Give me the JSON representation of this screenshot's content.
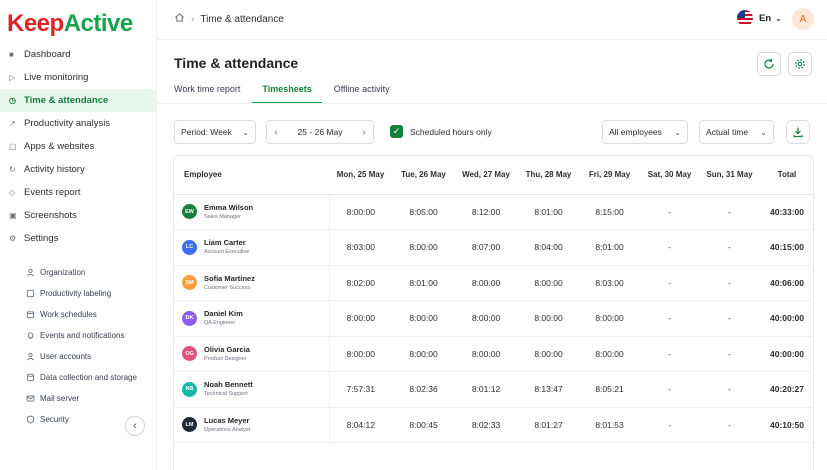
{
  "logo": {
    "part1": "Keep",
    "part2": "Active"
  },
  "nav": [
    {
      "label": "Dashboard",
      "icon": "■"
    },
    {
      "label": "Live monitoring",
      "icon": "▷"
    },
    {
      "label": "Time & attendance",
      "icon": "◷",
      "active": true
    },
    {
      "label": "Productivity analysis",
      "icon": "↗"
    },
    {
      "label": "Apps & websites",
      "icon": "▢"
    },
    {
      "label": "Activity history",
      "icon": "↻"
    },
    {
      "label": "Events report",
      "icon": "◇"
    },
    {
      "label": "Screenshots",
      "icon": "▣"
    },
    {
      "label": "Settings",
      "icon": "⚙"
    }
  ],
  "subnav": [
    "Organization",
    "Productivity labeling",
    "Work schedules",
    "Events and notifications",
    "User accounts",
    "Data collection and storage",
    "Mail server",
    "Security"
  ],
  "breadcrumb": {
    "current": "Time & attendance"
  },
  "lang": "En",
  "user_initial": "A",
  "page_title": "Time & attendance",
  "tabs": [
    "Work time report",
    "Timesheets",
    "Offline activity"
  ],
  "filters": {
    "period": "Period: Week",
    "range_start": "25",
    "range_sep": "-",
    "range_end": "26 May",
    "scheduled_only": "Scheduled hours only",
    "employees": "All employees",
    "time_mode": "Actual time"
  },
  "table": {
    "headers": [
      "Employee",
      "Mon, 25 May",
      "Tue, 26 May",
      "Wed, 27 May",
      "Thu, 28 May",
      "Fri, 29 May",
      "Sat, 30 May",
      "Sun, 31 May",
      "Total"
    ],
    "rows": [
      {
        "initials": "EW",
        "color": "#15803d",
        "name": "Emma Wilson",
        "role": "Sales Manager",
        "days": [
          "8:00:00",
          "8:05:00",
          "8:12:00",
          "8:01:00",
          "8:15:00",
          "-",
          "-"
        ],
        "total": "40:33:00"
      },
      {
        "initials": "LC",
        "color": "#3b6ff0",
        "name": "Liam Carter",
        "role": "Account Executive",
        "days": [
          "8:03:00",
          "8:00:00",
          "8:07:00",
          "8:04:00",
          "8:01:00",
          "-",
          "-"
        ],
        "total": "40:15:00"
      },
      {
        "initials": "SM",
        "color": "#f59e42",
        "name": "Sofia Martinez",
        "role": "Customer Success",
        "days": [
          "8:02:00",
          "8:01:00",
          "8:00:00",
          "8:00:00",
          "8:03:00",
          "-",
          "-"
        ],
        "total": "40:06:00"
      },
      {
        "initials": "DK",
        "color": "#8b5cf6",
        "name": "Daniel Kim",
        "role": "QA Engineer",
        "days": [
          "8:00:00",
          "8:00:00",
          "8:00:00",
          "8:00:00",
          "8:00:00",
          "-",
          "-"
        ],
        "total": "40:00:00"
      },
      {
        "initials": "OG",
        "color": "#e0537e",
        "name": "Olivia Garcia",
        "role": "Product Designer",
        "days": [
          "8:00:00",
          "8:00:00",
          "8:00:00",
          "8:00:00",
          "8:00:00",
          "-",
          "-"
        ],
        "total": "40:00:00"
      },
      {
        "initials": "NB",
        "color": "#14b8a6",
        "name": "Noah Bennett",
        "role": "Technical Support",
        "days": [
          "7:57:31",
          "8:02:36",
          "8:01:12",
          "8:13:47",
          "8:05:21",
          "-",
          "-"
        ],
        "total": "40:20:27"
      },
      {
        "initials": "LM",
        "color": "#1f2937",
        "name": "Lucas Meyer",
        "role": "Operations Analyst",
        "days": [
          "8:04:12",
          "8:00:45",
          "8:02:33",
          "8:01:27",
          "8:01:53",
          "-",
          "-"
        ],
        "total": "40:10:50"
      }
    ]
  }
}
